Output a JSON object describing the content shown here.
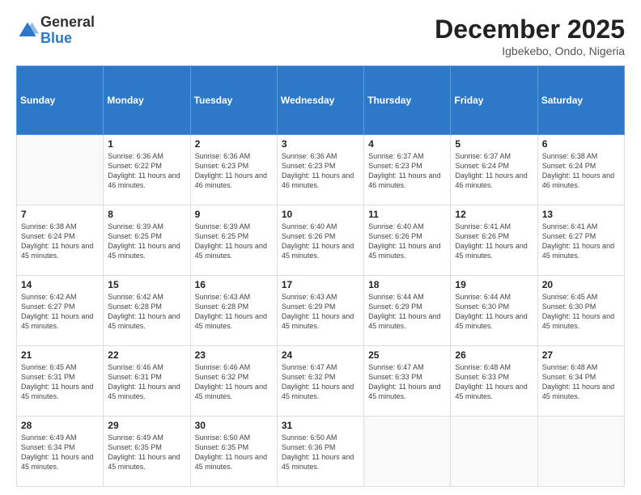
{
  "logo": {
    "general": "General",
    "blue": "Blue"
  },
  "header": {
    "month": "December 2025",
    "location": "Igbekebo, Ondo, Nigeria"
  },
  "weekdays": [
    "Sunday",
    "Monday",
    "Tuesday",
    "Wednesday",
    "Thursday",
    "Friday",
    "Saturday"
  ],
  "weeks": [
    [
      {
        "day": "",
        "sunrise": "",
        "sunset": "",
        "daylight": ""
      },
      {
        "day": "1",
        "sunrise": "Sunrise: 6:36 AM",
        "sunset": "Sunset: 6:22 PM",
        "daylight": "Daylight: 11 hours and 46 minutes."
      },
      {
        "day": "2",
        "sunrise": "Sunrise: 6:36 AM",
        "sunset": "Sunset: 6:23 PM",
        "daylight": "Daylight: 11 hours and 46 minutes."
      },
      {
        "day": "3",
        "sunrise": "Sunrise: 6:36 AM",
        "sunset": "Sunset: 6:23 PM",
        "daylight": "Daylight: 11 hours and 46 minutes."
      },
      {
        "day": "4",
        "sunrise": "Sunrise: 6:37 AM",
        "sunset": "Sunset: 6:23 PM",
        "daylight": "Daylight: 11 hours and 46 minutes."
      },
      {
        "day": "5",
        "sunrise": "Sunrise: 6:37 AM",
        "sunset": "Sunset: 6:24 PM",
        "daylight": "Daylight: 11 hours and 46 minutes."
      },
      {
        "day": "6",
        "sunrise": "Sunrise: 6:38 AM",
        "sunset": "Sunset: 6:24 PM",
        "daylight": "Daylight: 11 hours and 46 minutes."
      }
    ],
    [
      {
        "day": "7",
        "sunrise": "Sunrise: 6:38 AM",
        "sunset": "Sunset: 6:24 PM",
        "daylight": "Daylight: 11 hours and 45 minutes."
      },
      {
        "day": "8",
        "sunrise": "Sunrise: 6:39 AM",
        "sunset": "Sunset: 6:25 PM",
        "daylight": "Daylight: 11 hours and 45 minutes."
      },
      {
        "day": "9",
        "sunrise": "Sunrise: 6:39 AM",
        "sunset": "Sunset: 6:25 PM",
        "daylight": "Daylight: 11 hours and 45 minutes."
      },
      {
        "day": "10",
        "sunrise": "Sunrise: 6:40 AM",
        "sunset": "Sunset: 6:26 PM",
        "daylight": "Daylight: 11 hours and 45 minutes."
      },
      {
        "day": "11",
        "sunrise": "Sunrise: 6:40 AM",
        "sunset": "Sunset: 6:26 PM",
        "daylight": "Daylight: 11 hours and 45 minutes."
      },
      {
        "day": "12",
        "sunrise": "Sunrise: 6:41 AM",
        "sunset": "Sunset: 6:26 PM",
        "daylight": "Daylight: 11 hours and 45 minutes."
      },
      {
        "day": "13",
        "sunrise": "Sunrise: 6:41 AM",
        "sunset": "Sunset: 6:27 PM",
        "daylight": "Daylight: 11 hours and 45 minutes."
      }
    ],
    [
      {
        "day": "14",
        "sunrise": "Sunrise: 6:42 AM",
        "sunset": "Sunset: 6:27 PM",
        "daylight": "Daylight: 11 hours and 45 minutes."
      },
      {
        "day": "15",
        "sunrise": "Sunrise: 6:42 AM",
        "sunset": "Sunset: 6:28 PM",
        "daylight": "Daylight: 11 hours and 45 minutes."
      },
      {
        "day": "16",
        "sunrise": "Sunrise: 6:43 AM",
        "sunset": "Sunset: 6:28 PM",
        "daylight": "Daylight: 11 hours and 45 minutes."
      },
      {
        "day": "17",
        "sunrise": "Sunrise: 6:43 AM",
        "sunset": "Sunset: 6:29 PM",
        "daylight": "Daylight: 11 hours and 45 minutes."
      },
      {
        "day": "18",
        "sunrise": "Sunrise: 6:44 AM",
        "sunset": "Sunset: 6:29 PM",
        "daylight": "Daylight: 11 hours and 45 minutes."
      },
      {
        "day": "19",
        "sunrise": "Sunrise: 6:44 AM",
        "sunset": "Sunset: 6:30 PM",
        "daylight": "Daylight: 11 hours and 45 minutes."
      },
      {
        "day": "20",
        "sunrise": "Sunrise: 6:45 AM",
        "sunset": "Sunset: 6:30 PM",
        "daylight": "Daylight: 11 hours and 45 minutes."
      }
    ],
    [
      {
        "day": "21",
        "sunrise": "Sunrise: 6:45 AM",
        "sunset": "Sunset: 6:31 PM",
        "daylight": "Daylight: 11 hours and 45 minutes."
      },
      {
        "day": "22",
        "sunrise": "Sunrise: 6:46 AM",
        "sunset": "Sunset: 6:31 PM",
        "daylight": "Daylight: 11 hours and 45 minutes."
      },
      {
        "day": "23",
        "sunrise": "Sunrise: 6:46 AM",
        "sunset": "Sunset: 6:32 PM",
        "daylight": "Daylight: 11 hours and 45 minutes."
      },
      {
        "day": "24",
        "sunrise": "Sunrise: 6:47 AM",
        "sunset": "Sunset: 6:32 PM",
        "daylight": "Daylight: 11 hours and 45 minutes."
      },
      {
        "day": "25",
        "sunrise": "Sunrise: 6:47 AM",
        "sunset": "Sunset: 6:33 PM",
        "daylight": "Daylight: 11 hours and 45 minutes."
      },
      {
        "day": "26",
        "sunrise": "Sunrise: 6:48 AM",
        "sunset": "Sunset: 6:33 PM",
        "daylight": "Daylight: 11 hours and 45 minutes."
      },
      {
        "day": "27",
        "sunrise": "Sunrise: 6:48 AM",
        "sunset": "Sunset: 6:34 PM",
        "daylight": "Daylight: 11 hours and 45 minutes."
      }
    ],
    [
      {
        "day": "28",
        "sunrise": "Sunrise: 6:49 AM",
        "sunset": "Sunset: 6:34 PM",
        "daylight": "Daylight: 11 hours and 45 minutes."
      },
      {
        "day": "29",
        "sunrise": "Sunrise: 6:49 AM",
        "sunset": "Sunset: 6:35 PM",
        "daylight": "Daylight: 11 hours and 45 minutes."
      },
      {
        "day": "30",
        "sunrise": "Sunrise: 6:50 AM",
        "sunset": "Sunset: 6:35 PM",
        "daylight": "Daylight: 11 hours and 45 minutes."
      },
      {
        "day": "31",
        "sunrise": "Sunrise: 6:50 AM",
        "sunset": "Sunset: 6:36 PM",
        "daylight": "Daylight: 11 hours and 45 minutes."
      },
      {
        "day": "",
        "sunrise": "",
        "sunset": "",
        "daylight": ""
      },
      {
        "day": "",
        "sunrise": "",
        "sunset": "",
        "daylight": ""
      },
      {
        "day": "",
        "sunrise": "",
        "sunset": "",
        "daylight": ""
      }
    ]
  ]
}
